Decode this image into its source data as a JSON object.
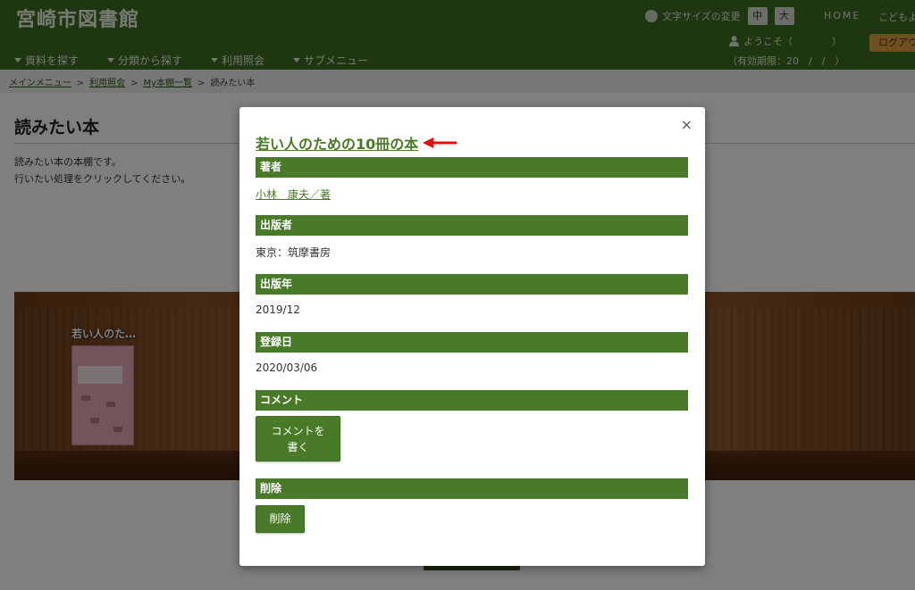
{
  "site": {
    "title": "宮崎市図書館"
  },
  "header": {
    "font_size_label": "文字サイズの変更",
    "font_size_mid": "中",
    "font_size_large": "大",
    "home": "HOME",
    "kids": "こどもよ",
    "welcome": "ようこそ（　　　　）",
    "logout": "ログアウ",
    "validity": "（有効期限：20　/　/　）"
  },
  "nav": [
    {
      "label": "資料を探す"
    },
    {
      "label": "分類から探す"
    },
    {
      "label": "利用照会"
    },
    {
      "label": "サブメニュー"
    }
  ],
  "breadcrumb": {
    "items": [
      "メインメニュー",
      "利用照会",
      "My本棚一覧"
    ],
    "current": "読みたい本",
    "sep": ">"
  },
  "page": {
    "title": "読みたい本",
    "desc1": "読みたい本の本棚です。",
    "desc2": "行いたい処理をクリックしてください。"
  },
  "shelf": {
    "book_title": "若い人のた…"
  },
  "modal": {
    "close": "×",
    "book_title": "若い人のための10冊の本",
    "author_header": "著者",
    "author": "小林　康夫／著",
    "publisher_header": "出版者",
    "publisher": "東京：筑摩書房",
    "pub_year_header": "出版年",
    "pub_year": "2019/12",
    "registered_header": "登録日",
    "registered": "2020/03/06",
    "comment_header": "コメント",
    "comment_button_line1": "コメントを",
    "comment_button_line2": "書く",
    "delete_header": "削除",
    "delete_button": "削除"
  }
}
